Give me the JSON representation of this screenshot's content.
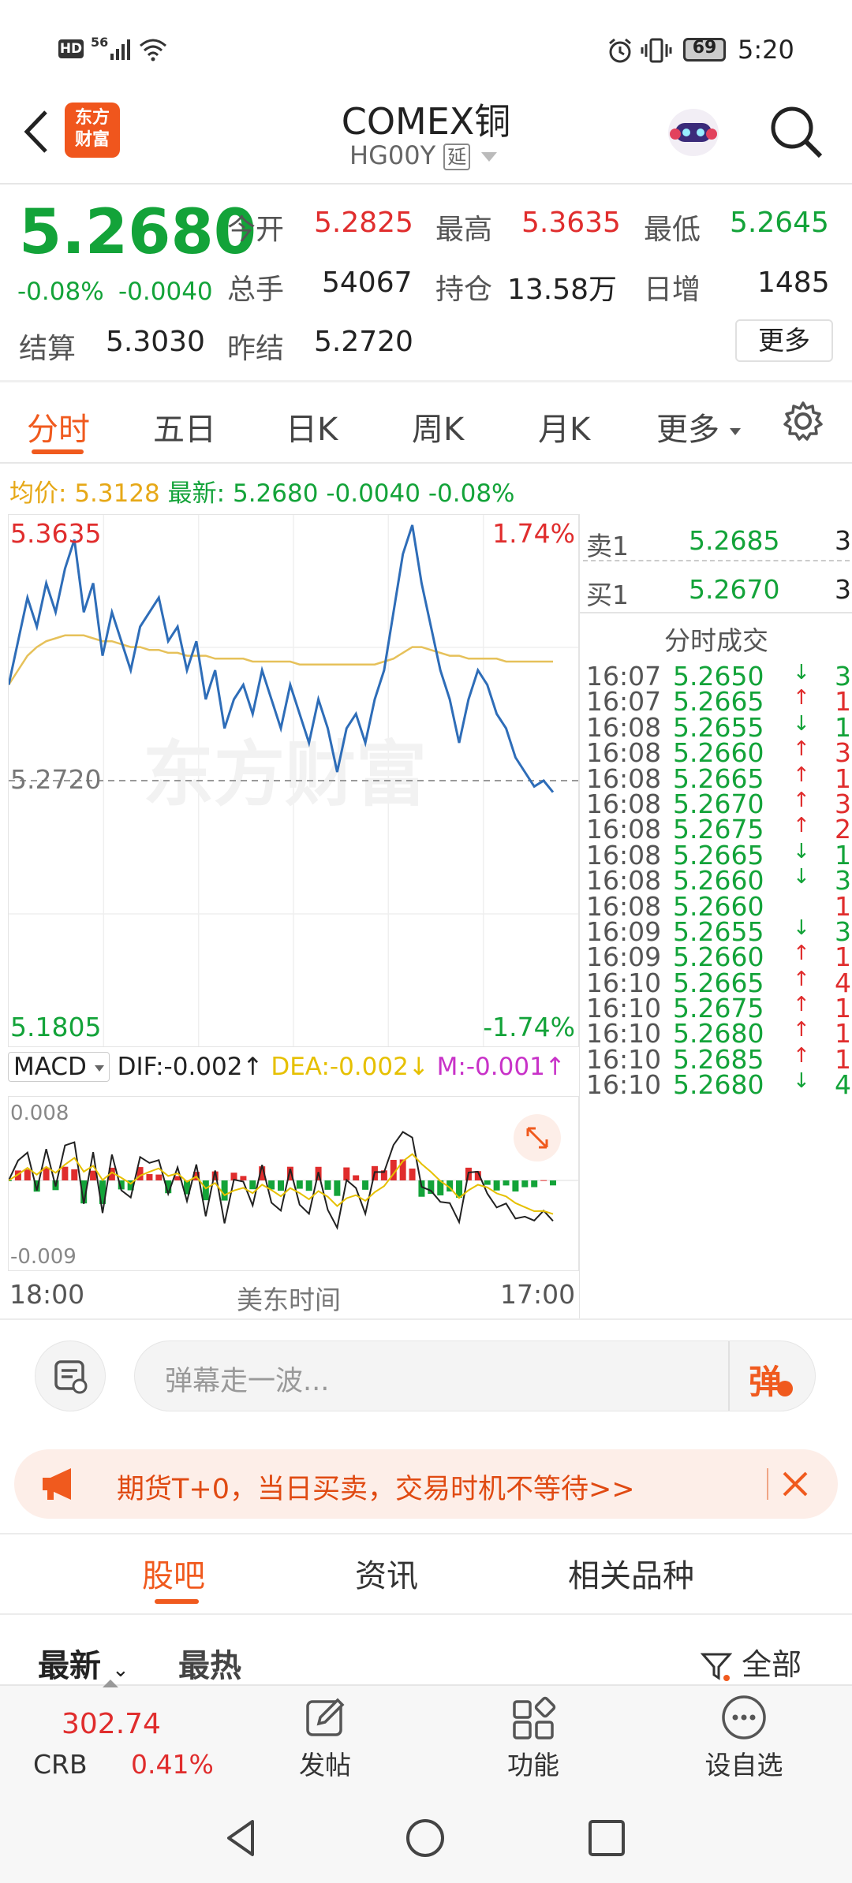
{
  "status_bar": {
    "left_icons": [
      "hd-icon",
      "signal-56-icon",
      "signal-bars-icon",
      "wifi-icon"
    ],
    "battery": "69",
    "time": "5:20",
    "hd": "HD",
    "net": "56"
  },
  "header": {
    "title": "COMEX铜",
    "code": "HG00Y",
    "delay_badge": "延",
    "logo_text": [
      "东方",
      "财富"
    ]
  },
  "quote": {
    "price": "5.2680",
    "change_pct": "-0.08%",
    "change": "-0.0040",
    "open_label": "今开",
    "open": "5.2825",
    "high_label": "最高",
    "high": "5.3635",
    "low_label": "最低",
    "low": "5.2645",
    "volume_label": "总手",
    "volume": "54067",
    "oi_label": "持仓",
    "oi": "13.58万",
    "daily_inc_label": "日增",
    "daily_inc": "1485",
    "settle_label": "结算",
    "settle": "5.3030",
    "prev_settle_label": "昨结",
    "prev_settle": "5.2720",
    "more_label": "更多"
  },
  "tabs": [
    {
      "label": "分时"
    },
    {
      "label": "五日"
    },
    {
      "label": "日K"
    },
    {
      "label": "周K"
    },
    {
      "label": "月K"
    },
    {
      "label": "更多"
    }
  ],
  "avg_line": {
    "avg_label": "均价:",
    "avg": "5.3128",
    "latest_label": "最新:",
    "latest": "5.2680",
    "change": "-0.0040",
    "pct": "-0.08%"
  },
  "chart_labels": {
    "top_price": "5.3635",
    "top_pct": "1.74%",
    "mid_price": "5.2720",
    "bottom_price": "5.1805",
    "bottom_pct": "-1.74%",
    "watermark": "东方财富",
    "macd_select": "MACD",
    "dif": "DIF:-0.002",
    "dea": "DEA:-0.002",
    "m": "M:-0.001",
    "macd_top": "0.008",
    "macd_bottom": "-0.009",
    "time_start": "18:00",
    "time_mid": "美东时间",
    "time_end": "17:00"
  },
  "chart_data": {
    "type": "line",
    "ylim": [
      5.1805,
      5.3635
    ],
    "reference": 5.272,
    "series": [
      {
        "values": [
          5.305,
          5.32,
          5.335,
          5.325,
          5.34,
          5.33,
          5.345,
          5.355,
          5.33,
          5.34,
          5.315,
          5.33,
          5.32,
          5.31,
          5.325,
          5.33,
          5.335,
          5.32,
          5.325,
          5.31,
          5.32,
          5.3,
          5.31,
          5.29,
          5.3,
          5.305,
          5.295,
          5.31,
          5.3,
          5.29,
          5.305,
          5.295,
          5.285,
          5.3,
          5.29,
          5.275,
          5.29,
          5.295,
          5.285,
          5.3,
          5.31,
          5.33,
          5.35,
          5.36,
          5.34,
          5.325,
          5.31,
          5.3,
          5.285,
          5.3,
          5.31,
          5.305,
          5.295,
          5.29,
          5.28,
          5.275,
          5.27,
          5.272,
          5.268
        ]
      },
      {
        "values": [
          5.305,
          5.31,
          5.315,
          5.318,
          5.32,
          5.321,
          5.322,
          5.322,
          5.322,
          5.321,
          5.32,
          5.32,
          5.319,
          5.318,
          5.318,
          5.317,
          5.317,
          5.316,
          5.316,
          5.315,
          5.315,
          5.315,
          5.314,
          5.314,
          5.314,
          5.314,
          5.313,
          5.313,
          5.313,
          5.313,
          5.313,
          5.312,
          5.312,
          5.312,
          5.312,
          5.312,
          5.312,
          5.312,
          5.312,
          5.312,
          5.313,
          5.314,
          5.316,
          5.318,
          5.318,
          5.317,
          5.316,
          5.315,
          5.315,
          5.314,
          5.314,
          5.314,
          5.314,
          5.313,
          5.313,
          5.313,
          5.313,
          5.313,
          5.313
        ]
      }
    ]
  },
  "order_book": {
    "sell_label": "卖1",
    "sell_price": "5.2685",
    "sell_qty": "3",
    "buy_label": "买1",
    "buy_price": "5.2670",
    "buy_qty": "3",
    "trades_title": "分时成交"
  },
  "trades": [
    {
      "time": "16:07",
      "price": "5.2650",
      "dir": "↓",
      "qty": "3"
    },
    {
      "time": "16:07",
      "price": "5.2665",
      "dir": "↑",
      "qty": "1"
    },
    {
      "time": "16:08",
      "price": "5.2655",
      "dir": "↓",
      "qty": "1"
    },
    {
      "time": "16:08",
      "price": "5.2660",
      "dir": "↑",
      "qty": "3"
    },
    {
      "time": "16:08",
      "price": "5.2665",
      "dir": "↑",
      "qty": "1"
    },
    {
      "time": "16:08",
      "price": "5.2670",
      "dir": "↑",
      "qty": "3"
    },
    {
      "time": "16:08",
      "price": "5.2675",
      "dir": "↑",
      "qty": "2"
    },
    {
      "time": "16:08",
      "price": "5.2665",
      "dir": "↓",
      "qty": "1"
    },
    {
      "time": "16:08",
      "price": "5.2660",
      "dir": "↓",
      "qty": "3"
    },
    {
      "time": "16:08",
      "price": "5.2660",
      "dir": "",
      "qty": "1"
    },
    {
      "time": "16:09",
      "price": "5.2655",
      "dir": "↓",
      "qty": "3"
    },
    {
      "time": "16:09",
      "price": "5.2660",
      "dir": "↑",
      "qty": "1"
    },
    {
      "time": "16:10",
      "price": "5.2665",
      "dir": "↑",
      "qty": "4"
    },
    {
      "time": "16:10",
      "price": "5.2675",
      "dir": "↑",
      "qty": "1"
    },
    {
      "time": "16:10",
      "price": "5.2680",
      "dir": "↑",
      "qty": "1"
    },
    {
      "time": "16:10",
      "price": "5.2685",
      "dir": "↑",
      "qty": "1"
    },
    {
      "time": "16:10",
      "price": "5.2680",
      "dir": "↓",
      "qty": "4"
    }
  ],
  "comment_bar": {
    "placeholder": "弹幕走一波...",
    "danmu_button": "弹"
  },
  "promo": {
    "text": "期货T+0，当日买卖，交易时机不等待>>"
  },
  "section_tabs": [
    {
      "label": "股吧"
    },
    {
      "label": "资讯"
    },
    {
      "label": "相关品种"
    }
  ],
  "filters": {
    "latest": "最新",
    "hottest": "最热",
    "all": "全部"
  },
  "bottom_bar": {
    "crb_value": "302.74",
    "crb_label": "CRB",
    "crb_pct": "0.41%",
    "post": "发帖",
    "features": "功能",
    "watchlist": "设自选"
  },
  "colors": {
    "accent": "#f05a1e",
    "up": "#e02d2d",
    "down": "#13a339",
    "line": "#2e6db8",
    "avg": "#e6c15a"
  }
}
